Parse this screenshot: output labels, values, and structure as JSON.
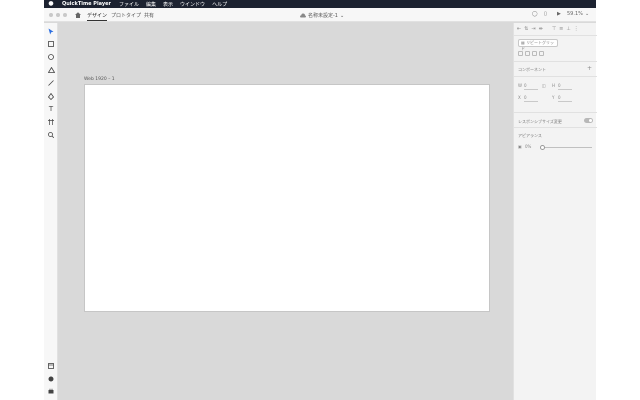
{
  "menubar": {
    "app_name": "QuickTime Player",
    "items": [
      "ファイル",
      "編集",
      "表示",
      "ウインドウ",
      "ヘルプ"
    ]
  },
  "titlebar": {
    "tabs": [
      "デザイン",
      "プロトタイプ",
      "共有"
    ],
    "active_tab": "デザイン",
    "doc_title": "名称未設定-1",
    "zoom": "59.1%"
  },
  "canvas": {
    "artboard_label": "Web 1920 – 1"
  },
  "inspector": {
    "repeat_grid_label": "リピートグリッド",
    "component_label": "コンポーネント",
    "w_label": "W",
    "w_value": "0",
    "h_label": "H",
    "h_value": "0",
    "x_label": "X",
    "x_value": "0",
    "y_label": "Y",
    "y_value": "0",
    "responsive_label": "レスポンシブサイズ変更",
    "appearance_label": "アピアランス",
    "opacity_value": "0%"
  },
  "colors": {
    "menubar_bg": "#1c2230",
    "canvas_bg": "#d9d9d9",
    "panel_bg": "#f7f7f7",
    "accent": "#2d6fe0"
  },
  "icons": {
    "tools": [
      "select-icon",
      "rectangle-icon",
      "ellipse-icon",
      "triangle-icon",
      "line-icon",
      "pen-icon",
      "text-icon",
      "artboard-icon",
      "zoom-icon"
    ],
    "bottom": [
      "layers-icon",
      "assets-icon",
      "plugins-icon"
    ]
  }
}
